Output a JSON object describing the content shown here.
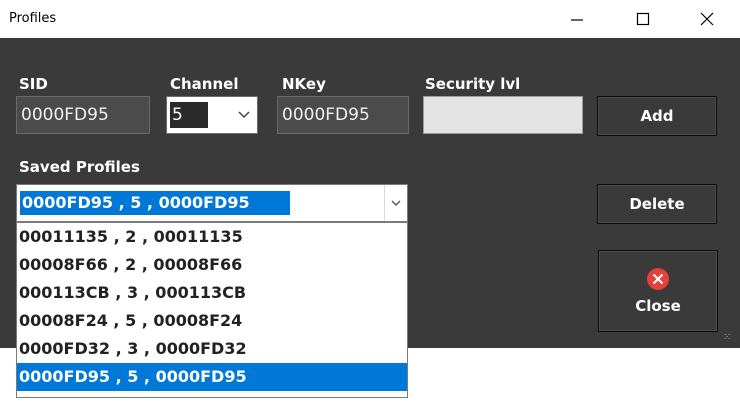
{
  "window": {
    "title": "Profiles",
    "minimize_icon": "minimize-icon",
    "maximize_icon": "maximize-icon",
    "close_icon": "close-x-icon"
  },
  "form": {
    "sid_label": "SID",
    "sid_value": "0000FD95",
    "channel_label": "Channel",
    "channel_value": "5",
    "nkey_label": "NKey",
    "nkey_value": "0000FD95",
    "security_label": "Security lvl",
    "security_value": ""
  },
  "buttons": {
    "add": "Add",
    "delete": "Delete",
    "close": "Close",
    "close_icon_color": "#e6403a"
  },
  "saved_profiles": {
    "label": "Saved Profiles",
    "selected": "0000FD95 , 5 , 0000FD95",
    "options": [
      "00011135 , 2 , 00011135",
      "00008F66 , 2 , 00008F66",
      "000113CB , 3 , 000113CB",
      "00008F24 , 5 , 00008F24",
      "0000FD32 , 3 , 0000FD32",
      "0000FD95 , 5 , 0000FD95"
    ]
  },
  "colors": {
    "client_bg": "#3a3a3a",
    "selection": "#0078d7"
  }
}
